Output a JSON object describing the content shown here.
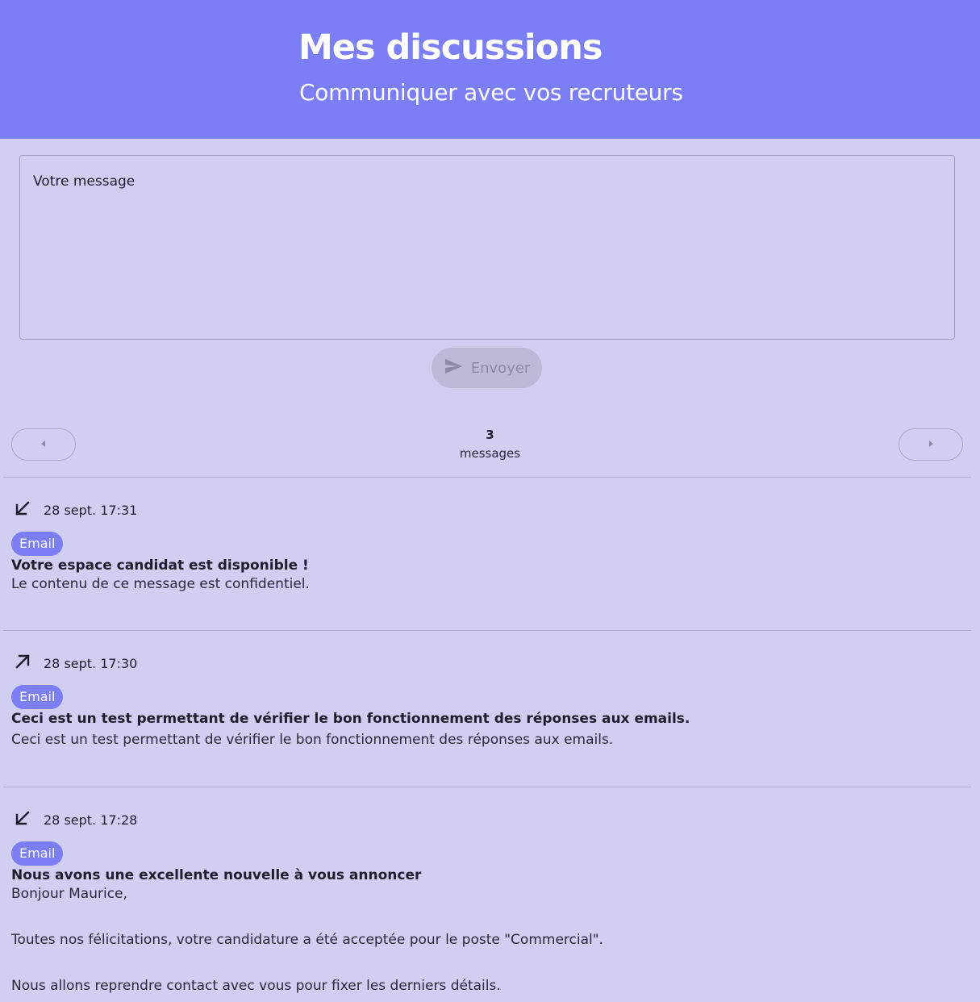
{
  "header": {
    "title": "Mes discussions",
    "subtitle": "Communiquer avec vos recruteurs"
  },
  "compose": {
    "placeholder": "Votre message",
    "send_label": "Envoyer"
  },
  "pager": {
    "count": "3",
    "count_label": "messages"
  },
  "messages": [
    {
      "direction": "incoming",
      "direction_icon": "arrow-down-left-icon",
      "date": "28 sept. 17:31",
      "channel": "Email",
      "subject": "Votre espace candidat est disponible !",
      "body": "Le contenu de ce message est confidentiel."
    },
    {
      "direction": "outgoing",
      "direction_icon": "arrow-up-right-icon",
      "date": "28 sept. 17:30",
      "channel": "Email",
      "subject": "Ceci est un test permettant de vérifier le bon fonctionnement des réponses aux emails.",
      "body": "Ceci est un test permettant de vérifier le bon fonctionnement des réponses aux emails."
    },
    {
      "direction": "incoming",
      "direction_icon": "arrow-down-left-icon",
      "date": "28 sept. 17:28",
      "channel": "Email",
      "subject": "Nous avons une excellente nouvelle à vous annoncer",
      "body": "Bonjour Maurice,\n\nToutes nos félicitations, votre candidature a été acceptée pour le poste \"Commercial\".\n\nNous allons reprendre contact avec vous pour fixer les derniers détails."
    }
  ],
  "colors": {
    "header_bg": "#7b7ef4",
    "page_bg": "#d0cff2",
    "badge_bg": "#7b7ef4",
    "send_disabled_bg": "#bcbad6"
  }
}
